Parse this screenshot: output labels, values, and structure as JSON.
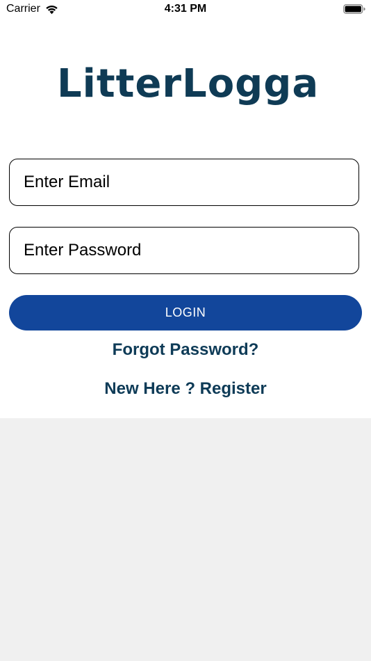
{
  "status_bar": {
    "carrier": "Carrier",
    "time": "4:31 PM"
  },
  "logo": {
    "text": "LitterLogga",
    "color": "#0f3b55"
  },
  "login_form": {
    "email_placeholder": "Enter Email",
    "email_value": "",
    "password_placeholder": "Enter Password",
    "password_value": "",
    "login_label": "LOGIN",
    "forgot_label": "Forgot Password?",
    "register_label": "New Here ? Register"
  },
  "colors": {
    "primary_button": "#12469b",
    "link": "#0e3b57",
    "lower_background": "#f0f0f0"
  }
}
